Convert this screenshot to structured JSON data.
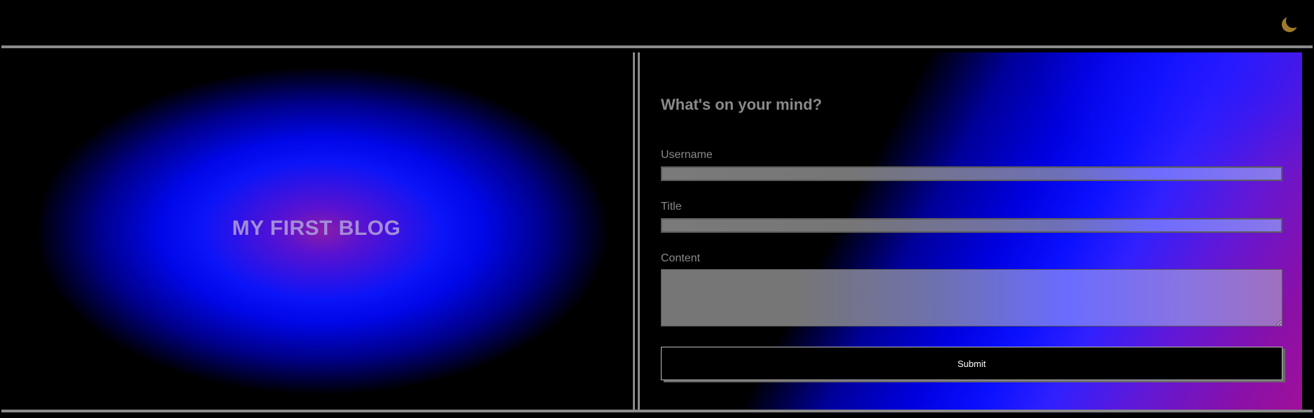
{
  "header": {
    "theme_toggle_icon": "crescent-moon-icon",
    "theme_toggle_color": "#a07a2a"
  },
  "hero": {
    "title": "MY FIRST BLOG"
  },
  "form": {
    "heading": "What's on your mind?",
    "username_label": "Username",
    "username_value": "",
    "title_label": "Title",
    "title_value": "",
    "content_label": "Content",
    "content_value": "",
    "submit_label": "Submit"
  },
  "colors": {
    "background": "#000000",
    "border": "#8a8a8a",
    "text_muted": "#8a8a8a",
    "title_text": "#a48cd8",
    "gradient_blue": "#0a10ff",
    "gradient_purple": "#8a10a8"
  }
}
